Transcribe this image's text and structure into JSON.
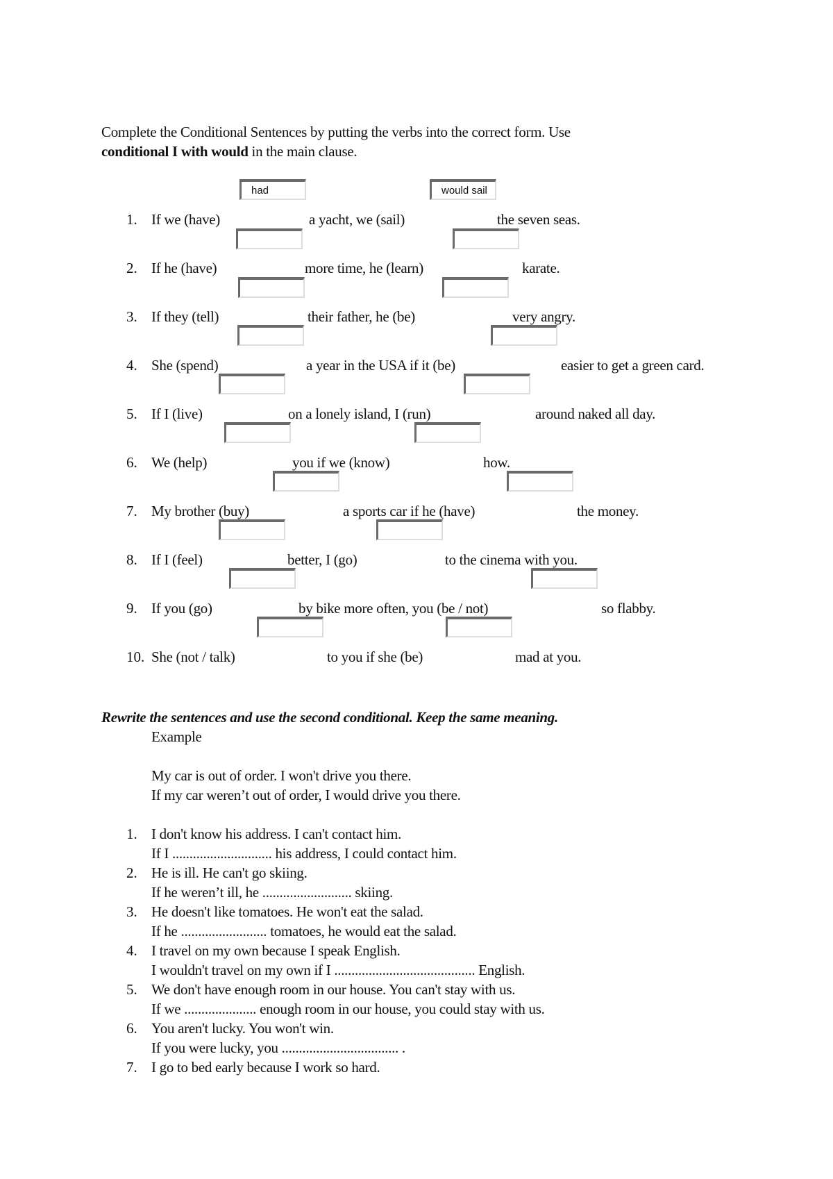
{
  "instructions": {
    "line1": "Complete the Conditional Sentences   by putting the verbs into the correct form. Use",
    "line2_bold": "conditional I with would",
    "line2_rest": " in the main clause."
  },
  "example_answers": [
    "had",
    "would sail"
  ],
  "exercise1": [
    {
      "num": "1.",
      "parts": [
        "If we (have)",
        "a yacht, we (sail)",
        "the seven seas."
      ],
      "answers": [
        "",
        ""
      ]
    },
    {
      "num": "2.",
      "parts": [
        "If he (have)",
        "more time, he (learn)",
        "karate."
      ],
      "answers": [
        "",
        ""
      ]
    },
    {
      "num": "3.",
      "parts": [
        "If they (tell)",
        "their father, he (be)",
        "very angry."
      ],
      "answers": [
        "",
        ""
      ]
    },
    {
      "num": "4.",
      "parts": [
        "She (spend)",
        "a year in the USA if it (be)",
        "easier to get a green card."
      ],
      "answers": [
        "",
        ""
      ]
    },
    {
      "num": "5.",
      "parts": [
        "If I (live)",
        "on a lonely island, I (run)",
        "around naked all day."
      ],
      "answers": [
        "",
        ""
      ]
    },
    {
      "num": "6.",
      "parts": [
        "We (help)",
        "you if we (know)",
        "how."
      ],
      "answers": [
        "",
        ""
      ]
    },
    {
      "num": "7.",
      "parts": [
        "My brother (buy)",
        "a sports car if he (have)",
        "the money."
      ],
      "answers": [
        "",
        ""
      ]
    },
    {
      "num": "8.",
      "parts": [
        "If I (feel)",
        "better, I (go)",
        "to the cinema with you."
      ],
      "answers": [
        "",
        ""
      ]
    },
    {
      "num": "9.",
      "parts": [
        "If you (go)",
        "by bike more often, you (be / not)",
        "so flabby."
      ],
      "answers": [
        "",
        ""
      ]
    },
    {
      "num": "10.",
      "parts": [
        "She (not / talk)",
        "to you if she (be)",
        "mad at you."
      ],
      "answers": [
        "",
        ""
      ]
    }
  ],
  "section2": {
    "heading": "Rewrite the sentences and use the second conditional. Keep the same meaning.",
    "example_label": "Example",
    "example_line1": "My car is out of order. I won't drive you there.",
    "example_line2": "If my car weren’t out of order, I would drive you there.",
    "items": [
      {
        "num": "1.",
        "sentence": "I don't know his address. I can't contact him.",
        "rewrite": "If I ............................. his address, I could contact him."
      },
      {
        "num": "2.",
        "sentence": "He is ill. He can't go skiing.",
        "rewrite": "If he weren’t ill, he .......................... skiing."
      },
      {
        "num": "3.",
        "sentence": "He doesn't like tomatoes. He won't eat the salad.",
        "rewrite": "If he ......................... tomatoes, he would eat the salad."
      },
      {
        "num": "4.",
        "sentence": "I travel on my own because I speak English.",
        "rewrite": "I wouldn't travel on my own if I ......................................... English."
      },
      {
        "num": "5.",
        "sentence": "We don't have enough room in our house. You can't stay with us.",
        "rewrite": "If we ..................... enough room in our house, you could stay with us."
      },
      {
        "num": "6.",
        "sentence": "You aren't lucky. You won't win.",
        "rewrite": "If you were lucky, you .................................. ."
      },
      {
        "num": "7.",
        "sentence": "I go to bed early because I work so hard.",
        "rewrite": ""
      }
    ]
  }
}
